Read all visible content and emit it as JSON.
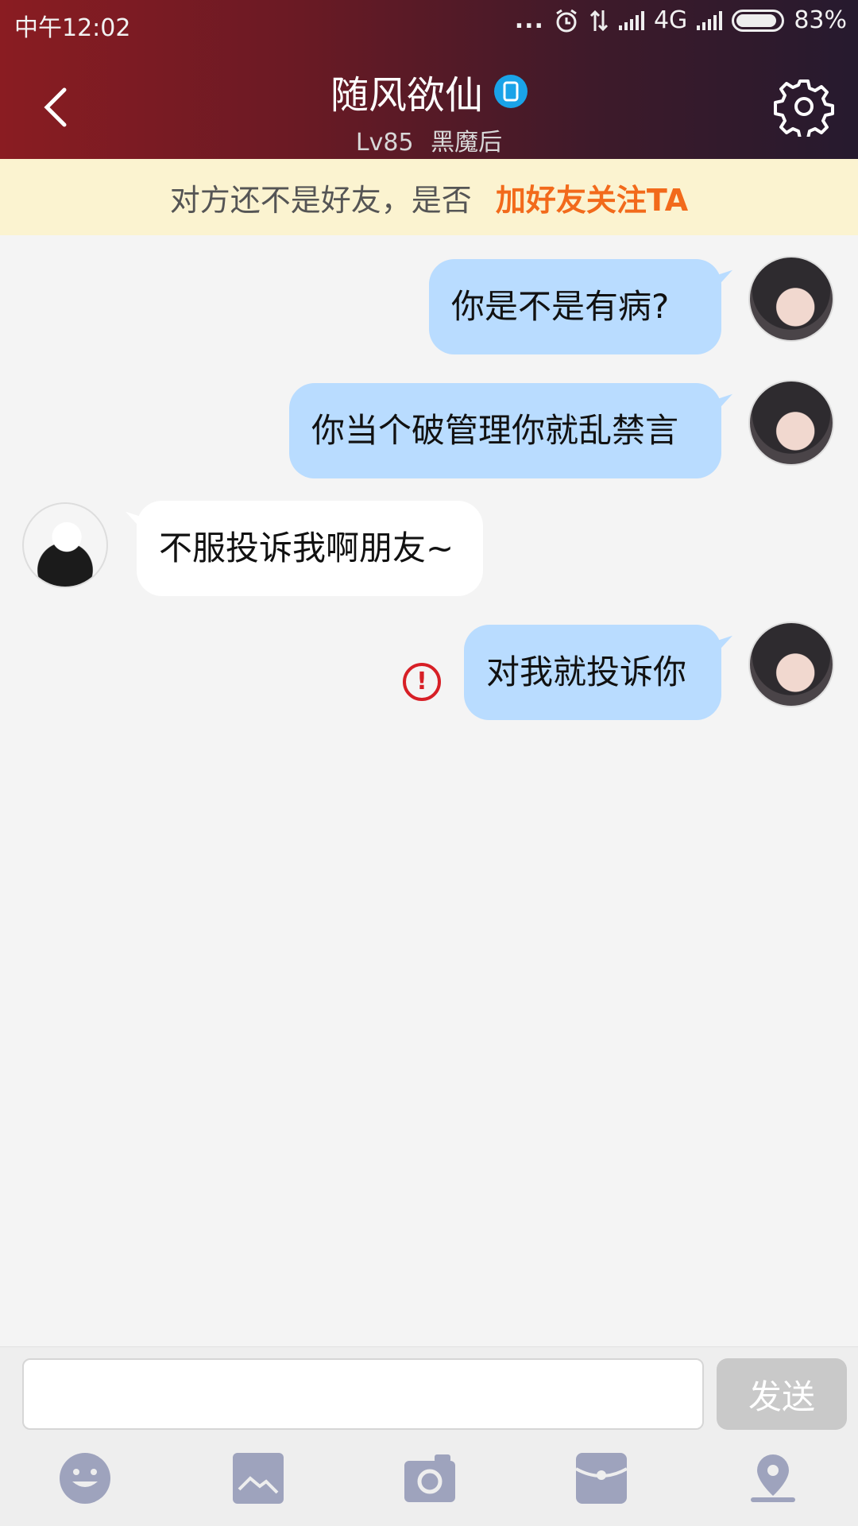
{
  "status_bar": {
    "time": "中午12:02",
    "dots": "...",
    "network": "4G",
    "battery": "83%"
  },
  "header": {
    "title": "随风欲仙",
    "level": "Lv85",
    "rank": "黑魔后"
  },
  "banner": {
    "text": "对方还不是好友，是否",
    "link": "加好友关注TA",
    "link_color": "#f26a1b"
  },
  "messages": [
    {
      "from": "me",
      "text": "你是不是有病?"
    },
    {
      "from": "me",
      "text": "你当个破管理你就乱禁言"
    },
    {
      "from": "other",
      "text": "不服投诉我啊朋友~"
    },
    {
      "from": "me",
      "text": "对我就投诉你",
      "error": "!"
    }
  ],
  "input": {
    "value": "",
    "placeholder": ""
  },
  "send_label": "发送",
  "colors": {
    "my_bubble": "#b9dcff",
    "their_bubble": "#ffffff",
    "error": "#d71f26",
    "header_start": "#8a1c22",
    "header_end": "#261a2e"
  },
  "toolbar_icons": [
    "emoji-icon",
    "image-icon",
    "camera-icon",
    "red-packet-icon",
    "location-icon"
  ]
}
